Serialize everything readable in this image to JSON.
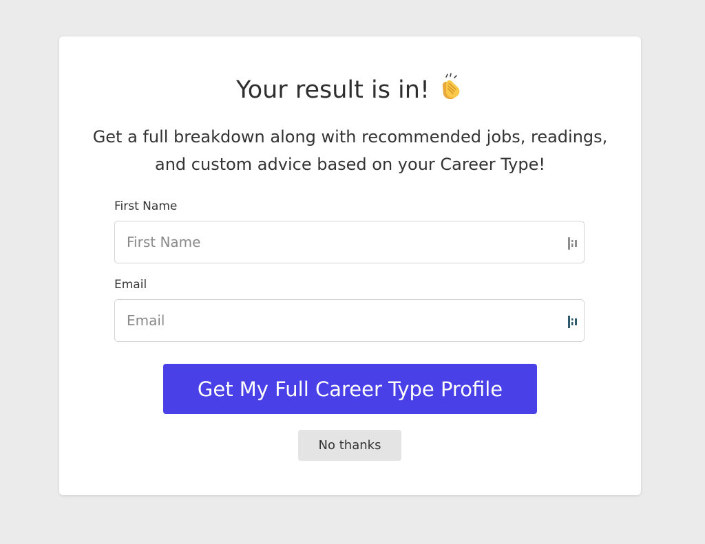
{
  "modal": {
    "title": "Your result is in!",
    "title_icon": "clapping-hands-icon",
    "subtitle": "Get a full breakdown along with recommended jobs, readings, and custom advice based on your Career Type!"
  },
  "form": {
    "first_name": {
      "label": "First Name",
      "placeholder": "First Name",
      "value": "",
      "icon": "autofill-icon"
    },
    "email": {
      "label": "Email",
      "placeholder": "Email",
      "value": "",
      "icon": "autofill-icon"
    },
    "submit_label": "Get My Full Career Type Profile",
    "decline_label": "No thanks"
  },
  "colors": {
    "background": "#ebebeb",
    "card": "#ffffff",
    "primary_button": "#4a40e8",
    "secondary_button": "#e4e4e4",
    "text": "#333333"
  }
}
